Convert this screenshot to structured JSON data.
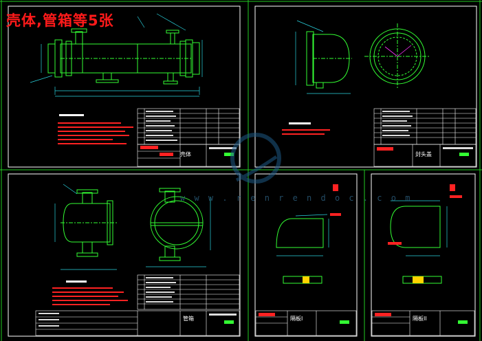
{
  "overlay_title": "壳体,管箱等5张",
  "watermark_text": "w w w . r e n r e n d o c . c o m",
  "colors": {
    "background": "#000000",
    "frame": "#ffffff",
    "separator": "#22cc22",
    "geometry": "#33ff33",
    "dimension": "#2ad4e0",
    "notes": "#ff2222",
    "title_block": "#ffffff",
    "hatch": "#ffd400",
    "magenta": "#ff33ff"
  },
  "sheets": [
    {
      "id": "shell",
      "label": "壳体"
    },
    {
      "id": "head",
      "label": "封头盖"
    },
    {
      "id": "channel",
      "label": "管箱"
    },
    {
      "id": "partition-1",
      "label": "隔板I"
    },
    {
      "id": "partition-2",
      "label": "隔板II"
    }
  ]
}
